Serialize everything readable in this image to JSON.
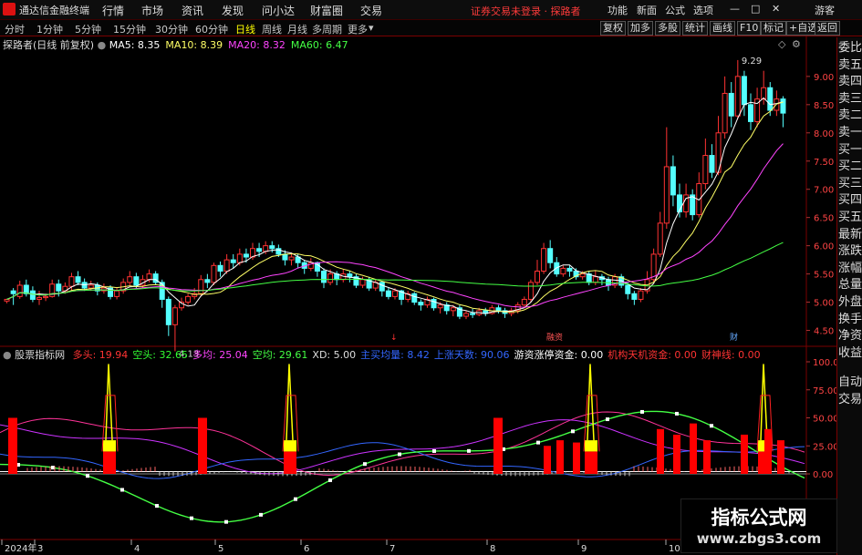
{
  "app": {
    "title": "通达信金融终端"
  },
  "menu": [
    "行情",
    "市场",
    "资讯",
    "发现",
    "问小达",
    "财富圈",
    "交易"
  ],
  "notice": "证券交易未登录 · 探路者",
  "right_menu": [
    "功能",
    "新面",
    "公式",
    "选项"
  ],
  "user": "游客",
  "periods": [
    "分时",
    "1分钟",
    "5分钟",
    "15分钟",
    "30分钟",
    "60分钟",
    "日线",
    "周线",
    "月线",
    "多周期",
    "更多"
  ],
  "active_period": "日线",
  "toolbar_right": [
    "复权",
    "加多",
    "多股",
    "统计",
    "画线",
    "F10",
    "标记",
    "+自选",
    "返回"
  ],
  "chart_header": {
    "stock": "探路者(日线 前复权)",
    "ma": [
      {
        "label": "MA5: 8.35",
        "color": "#ffffff"
      },
      {
        "label": "MA10: 8.39",
        "color": "#ffff66"
      },
      {
        "label": "MA20: 8.32",
        "color": "#ff44ff"
      },
      {
        "label": "MA60: 6.47",
        "color": "#44ff44"
      }
    ]
  },
  "sidebar": [
    "委比",
    "卖五",
    "卖四",
    "卖三",
    "卖二",
    "卖一",
    "买一",
    "买二",
    "买三",
    "买四",
    "买五",
    "最新",
    "涨跌",
    "涨幅",
    "总量",
    "外盘",
    "换手",
    "净资",
    "收益",
    "自动",
    "交易"
  ],
  "price_axis": [
    "9.00",
    "8.50",
    "8.00",
    "7.50",
    "7.00",
    "6.50",
    "6.00",
    "5.50",
    "5.00",
    "4.50"
  ],
  "price_annotations": {
    "high": "9.29",
    "low": "4.13"
  },
  "event_marks": [
    "↓",
    "融资",
    "财"
  ],
  "indicator": {
    "name": "股票指标网",
    "items": [
      {
        "label": "多头: 19.94",
        "color": "#ff3333"
      },
      {
        "label": "空头: 32.65",
        "color": "#33ff33"
      },
      {
        "label": "多均: 25.04",
        "color": "#ff44ff"
      },
      {
        "label": "空均: 29.61",
        "color": "#44ff44"
      },
      {
        "label": "XD: 5.00",
        "color": "#dddddd"
      },
      {
        "label": "主买均量: 8.42",
        "color": "#3366ff"
      },
      {
        "label": "上涨天数: 90.06",
        "color": "#3366ff"
      },
      {
        "label": "游资涨停资金: 0.00",
        "color": "#ffffff"
      },
      {
        "label": "机构天机资金: 0.00",
        "color": "#ff3333"
      },
      {
        "label": "财神线: 0.00",
        "color": "#ff3333"
      }
    ],
    "axis": [
      "100.0",
      "75.00",
      "50.00",
      "25.00",
      "0.00"
    ]
  },
  "date_axis": [
    "2024年",
    "3",
    "4",
    "5",
    "6",
    "7",
    "8",
    "9",
    "10"
  ],
  "watermark": {
    "line1": "指标公式网",
    "line2": "www.zbgs3.com"
  },
  "chart_data": {
    "type": "candlestick",
    "ylim": [
      4.25,
      9.45
    ],
    "candles": [
      [
        5.02,
        5.05,
        5.04,
        4.98
      ],
      [
        5.2,
        5.15,
        4.95,
        5.25
      ],
      [
        5.1,
        5.3,
        5.06,
        5.38
      ],
      [
        5.3,
        5.15,
        5.1,
        5.4
      ],
      [
        5.2,
        5.05,
        5.0,
        5.28
      ],
      [
        5.05,
        5.08,
        4.95,
        5.2
      ],
      [
        5.08,
        5.1,
        5.02,
        5.15
      ],
      [
        5.1,
        5.32,
        5.08,
        5.4
      ],
      [
        5.32,
        5.2,
        5.1,
        5.4
      ],
      [
        5.2,
        5.28,
        5.15,
        5.35
      ],
      [
        5.28,
        5.45,
        5.2,
        5.52
      ],
      [
        5.45,
        5.35,
        5.3,
        5.55
      ],
      [
        5.35,
        5.25,
        5.2,
        5.42
      ],
      [
        5.25,
        5.3,
        5.2,
        5.38
      ],
      [
        5.3,
        5.2,
        5.12,
        5.35
      ],
      [
        5.2,
        5.25,
        5.15,
        5.33
      ],
      [
        5.25,
        5.1,
        5.05,
        5.3
      ],
      [
        5.1,
        5.2,
        5.05,
        5.25
      ],
      [
        5.2,
        5.35,
        5.15,
        5.42
      ],
      [
        5.35,
        5.45,
        5.3,
        5.55
      ],
      [
        5.45,
        5.3,
        5.25,
        5.52
      ],
      [
        5.3,
        5.4,
        5.25,
        5.48
      ],
      [
        5.4,
        5.5,
        5.35,
        5.58
      ],
      [
        5.5,
        5.35,
        5.3,
        5.55
      ],
      [
        5.35,
        5.05,
        4.9,
        5.4
      ],
      [
        5.05,
        4.6,
        4.4,
        5.1
      ],
      [
        4.6,
        4.9,
        4.13,
        4.95
      ],
      [
        4.9,
        5.0,
        4.85,
        5.08
      ],
      [
        5.0,
        5.1,
        4.95,
        5.15
      ],
      [
        5.1,
        5.15,
        5.05,
        5.25
      ],
      [
        5.15,
        5.4,
        5.1,
        5.48
      ],
      [
        5.4,
        5.35,
        5.25,
        5.5
      ],
      [
        5.35,
        5.65,
        5.3,
        5.7
      ],
      [
        5.65,
        5.55,
        5.45,
        5.72
      ],
      [
        5.55,
        5.75,
        5.5,
        5.85
      ],
      [
        5.75,
        5.7,
        5.6,
        5.85
      ],
      [
        5.7,
        5.85,
        5.65,
        5.95
      ],
      [
        5.85,
        5.8,
        5.7,
        5.95
      ],
      [
        5.8,
        5.95,
        5.75,
        6.05
      ],
      [
        5.95,
        5.9,
        5.8,
        6.05
      ],
      [
        5.9,
        6.0,
        5.85,
        6.08
      ],
      [
        6.0,
        5.95,
        5.88,
        6.08
      ],
      [
        5.95,
        5.85,
        5.8,
        6.02
      ],
      [
        5.85,
        5.75,
        5.65,
        5.92
      ],
      [
        5.75,
        5.8,
        5.65,
        5.88
      ],
      [
        5.8,
        5.7,
        5.6,
        5.85
      ],
      [
        5.7,
        5.6,
        5.5,
        5.75
      ],
      [
        5.6,
        5.7,
        5.55,
        5.78
      ],
      [
        5.7,
        5.55,
        5.45,
        5.72
      ],
      [
        5.55,
        5.35,
        5.25,
        5.6
      ],
      [
        5.35,
        5.5,
        5.3,
        5.58
      ],
      [
        5.5,
        5.4,
        5.3,
        5.55
      ],
      [
        5.4,
        5.5,
        5.35,
        5.58
      ],
      [
        5.5,
        5.45,
        5.35,
        5.55
      ],
      [
        5.45,
        5.3,
        5.25,
        5.5
      ],
      [
        5.3,
        5.4,
        5.25,
        5.45
      ],
      [
        5.4,
        5.25,
        5.2,
        5.45
      ],
      [
        5.25,
        5.35,
        5.2,
        5.4
      ],
      [
        5.35,
        5.2,
        5.1,
        5.38
      ],
      [
        5.2,
        5.1,
        5.05,
        5.25
      ],
      [
        5.1,
        5.2,
        5.05,
        5.25
      ],
      [
        5.2,
        5.05,
        4.95,
        5.22
      ],
      [
        5.05,
        5.15,
        5.0,
        5.2
      ],
      [
        5.15,
        5.0,
        4.95,
        5.18
      ],
      [
        5.0,
        4.95,
        4.85,
        5.05
      ],
      [
        4.95,
        5.05,
        4.9,
        5.1
      ],
      [
        5.05,
        4.9,
        4.85,
        5.08
      ],
      [
        4.9,
        4.95,
        4.8,
        5.0
      ],
      [
        4.95,
        4.85,
        4.78,
        5.0
      ],
      [
        4.85,
        4.9,
        4.75,
        4.95
      ],
      [
        4.9,
        4.75,
        4.7,
        4.95
      ],
      [
        4.75,
        4.8,
        4.7,
        4.85
      ],
      [
        4.8,
        4.78,
        4.72,
        4.88
      ],
      [
        4.78,
        4.85,
        4.75,
        4.9
      ],
      [
        4.85,
        4.8,
        4.75,
        4.9
      ],
      [
        4.8,
        4.9,
        4.78,
        4.95
      ],
      [
        4.9,
        4.85,
        4.8,
        4.95
      ],
      [
        4.85,
        4.8,
        4.72,
        4.9
      ],
      [
        4.8,
        4.85,
        4.75,
        4.9
      ],
      [
        4.85,
        4.95,
        4.8,
        5.0
      ],
      [
        4.95,
        5.05,
        4.9,
        5.1
      ],
      [
        5.05,
        5.35,
        5.0,
        5.4
      ],
      [
        5.35,
        5.55,
        5.3,
        5.75
      ],
      [
        5.55,
        5.95,
        5.5,
        6.05
      ],
      [
        5.95,
        5.7,
        5.6,
        6.1
      ],
      [
        5.7,
        5.5,
        5.45,
        5.8
      ],
      [
        5.5,
        5.6,
        5.45,
        5.65
      ],
      [
        5.6,
        5.55,
        5.45,
        5.65
      ],
      [
        5.55,
        5.45,
        5.4,
        5.6
      ],
      [
        5.45,
        5.5,
        5.4,
        5.55
      ],
      [
        5.5,
        5.35,
        5.3,
        5.55
      ],
      [
        5.35,
        5.45,
        5.3,
        5.55
      ],
      [
        5.45,
        5.4,
        5.3,
        5.5
      ],
      [
        5.4,
        5.3,
        5.2,
        5.45
      ],
      [
        5.3,
        5.45,
        5.25,
        5.5
      ],
      [
        5.45,
        5.3,
        5.25,
        5.5
      ],
      [
        5.3,
        5.15,
        5.05,
        5.35
      ],
      [
        5.15,
        5.05,
        4.95,
        5.2
      ],
      [
        5.05,
        5.2,
        5.0,
        5.25
      ],
      [
        5.2,
        5.4,
        5.15,
        5.55
      ],
      [
        5.4,
        5.85,
        5.35,
        5.95
      ],
      [
        5.85,
        6.4,
        5.8,
        6.6
      ],
      [
        6.4,
        7.4,
        6.3,
        8.1
      ],
      [
        7.4,
        6.9,
        6.7,
        7.6
      ],
      [
        6.9,
        6.6,
        6.5,
        7.1
      ],
      [
        6.6,
        6.9,
        6.5,
        7.1
      ],
      [
        6.9,
        6.55,
        6.45,
        7.0
      ],
      [
        6.55,
        7.1,
        6.5,
        7.3
      ],
      [
        7.1,
        7.6,
        7.0,
        7.9
      ],
      [
        7.6,
        7.3,
        7.2,
        7.8
      ],
      [
        7.3,
        8.0,
        7.25,
        8.3
      ],
      [
        8.0,
        8.7,
        7.9,
        9.0
      ],
      [
        8.7,
        8.3,
        8.1,
        8.9
      ],
      [
        8.3,
        9.0,
        8.25,
        9.29
      ],
      [
        9.0,
        8.5,
        8.3,
        9.1
      ],
      [
        8.5,
        8.2,
        8.05,
        8.7
      ],
      [
        8.2,
        8.6,
        8.1,
        8.8
      ],
      [
        8.6,
        8.8,
        8.5,
        9.1
      ],
      [
        8.8,
        8.4,
        8.3,
        8.9
      ],
      [
        8.4,
        8.6,
        8.3,
        8.75
      ],
      [
        8.6,
        8.35,
        8.1,
        8.65
      ]
    ]
  }
}
